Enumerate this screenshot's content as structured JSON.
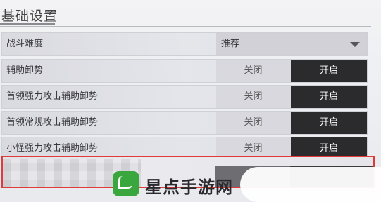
{
  "page": {
    "title": "基础设置"
  },
  "settings": {
    "difficulty": {
      "label": "战斗难度",
      "value": "推荐"
    },
    "rows": [
      {
        "label": "辅助卸势",
        "off": "关闭",
        "on": "开启"
      },
      {
        "label": "首领强力攻击辅助卸势",
        "off": "关闭",
        "on": "开启"
      },
      {
        "label": "首领常规攻击辅助卸势",
        "off": "关闭",
        "on": "开启"
      },
      {
        "label": "小怪强力攻击辅助卸势",
        "off": "关闭",
        "on": "开启"
      }
    ]
  },
  "colors": {
    "highlight": "#e03a3a",
    "active_option": "#2b2b2e",
    "watermark_logo": "#3aa63e"
  },
  "watermark": {
    "text": "星点手游网",
    "icon": "leaf-logo-icon"
  }
}
